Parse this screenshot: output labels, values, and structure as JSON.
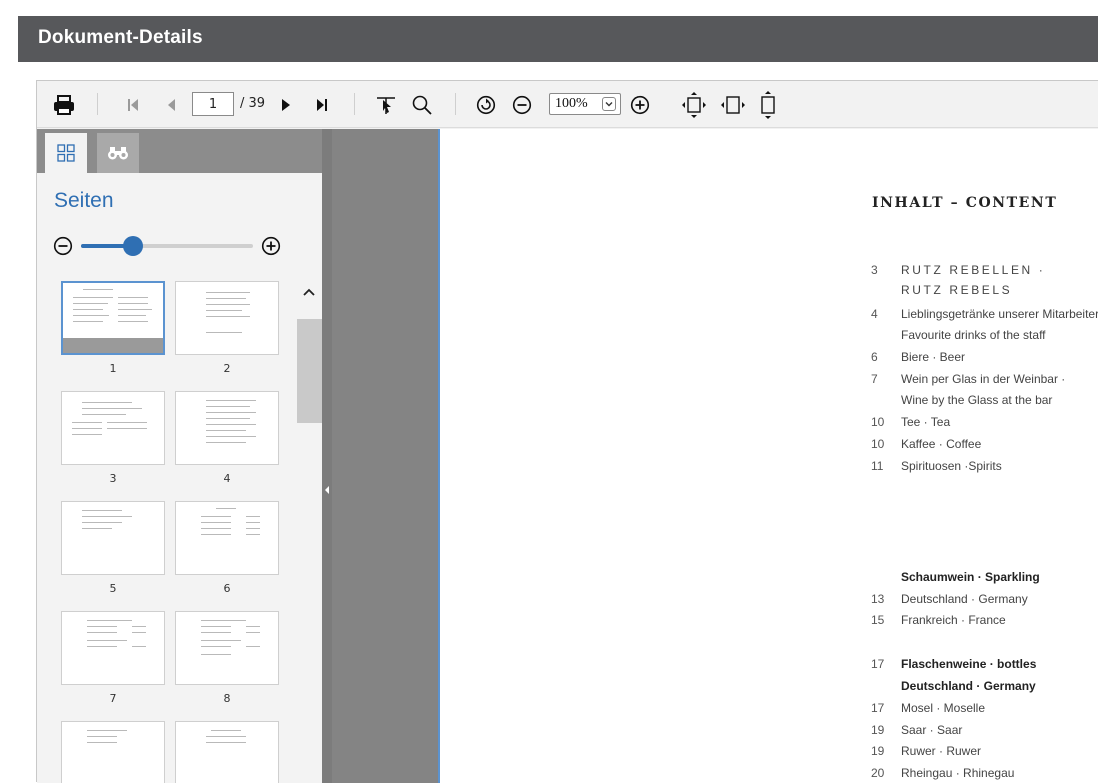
{
  "app": {
    "title": "Dokument-Details"
  },
  "toolbar": {
    "page_current": "1",
    "page_total": "/ 39",
    "zoom": "100%"
  },
  "sidebar": {
    "title": "Seiten",
    "thumb_zoom": 0.3,
    "thumbnails": [
      {
        "label": "1",
        "selected": true
      },
      {
        "label": "2"
      },
      {
        "label": "3"
      },
      {
        "label": "4"
      },
      {
        "label": "5"
      },
      {
        "label": "6"
      },
      {
        "label": "7"
      },
      {
        "label": "8"
      },
      {
        "label": ""
      },
      {
        "label": ""
      }
    ]
  },
  "document": {
    "heading": "INHALT – CONTENT",
    "toc": [
      {
        "num": "3",
        "text": "RUTZ REBELLEN ·",
        "style": "spaced"
      },
      {
        "num": "",
        "text": "RUTZ REBELS",
        "style": "spaced"
      },
      {
        "num": "4",
        "text": "Lieblingsgetränke unserer Mitarbeiter",
        "style": ""
      },
      {
        "num": "",
        "text": "Favourite drinks of the staff",
        "style": ""
      },
      {
        "num": "6",
        "text": "Biere · Beer",
        "style": ""
      },
      {
        "num": "7",
        "text": "Wein per Glas in der Weinbar ·",
        "style": ""
      },
      {
        "num": "",
        "text": "Wine by the Glass at the bar",
        "style": ""
      },
      {
        "num": "10",
        "text": "Tee · Tea",
        "style": ""
      },
      {
        "num": "10",
        "text": "Kaffee · Coffee",
        "style": ""
      },
      {
        "num": "11",
        "text": "Spirituosen ·Spirits",
        "style": ""
      },
      {
        "num": "",
        "text": "Schaumwein · Sparkling",
        "style": "bold"
      },
      {
        "num": "13",
        "text": "Deutschland · Germany",
        "style": ""
      },
      {
        "num": "15",
        "text": "Frankreich · France",
        "style": ""
      },
      {
        "num": "17",
        "text": "Flaschenweine · bottles",
        "style": "bold"
      },
      {
        "num": "",
        "text": "Deutschland · Germany",
        "style": "bold"
      },
      {
        "num": "17",
        "text": "Mosel · Moselle",
        "style": ""
      },
      {
        "num": "19",
        "text": "Saar · Saar",
        "style": ""
      },
      {
        "num": "19",
        "text": "Ruwer · Ruwer",
        "style": ""
      },
      {
        "num": "20",
        "text": "Rheingau · Rhinegau",
        "style": ""
      }
    ]
  }
}
